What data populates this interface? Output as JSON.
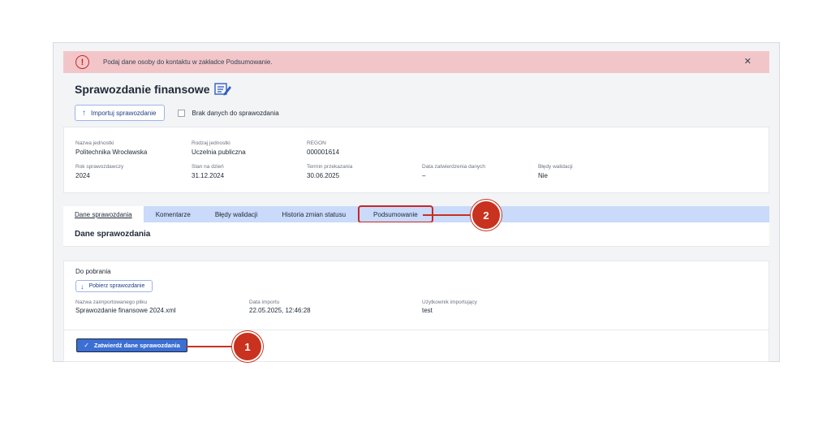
{
  "alert": {
    "text": "Podaj dane osoby do kontaktu w zakładce Podsumowanie.",
    "icon": "alert-circle-icon",
    "close": "✕"
  },
  "page": {
    "title": "Sprawozdanie finansowe"
  },
  "toolbar": {
    "import_label": "Importuj sprawozdanie",
    "no_data_label": "Brak danych do sprawozdania"
  },
  "info": {
    "row1": [
      {
        "label": "Nazwa jednostki",
        "value": "Politechnika Wrocławska"
      },
      {
        "label": "Rodzaj jednostki",
        "value": "Uczelnia publiczna"
      },
      {
        "label": "REGON",
        "value": "000001614"
      }
    ],
    "row2": [
      {
        "label": "Rok sprawozdawczy",
        "value": "2024"
      },
      {
        "label": "Stan na dzień",
        "value": "31.12.2024"
      },
      {
        "label": "Termin przekazania",
        "value": "30.06.2025"
      },
      {
        "label": "Data zatwierdzenia danych",
        "value": "–"
      },
      {
        "label": "Błędy walidacji",
        "value": "Nie"
      }
    ]
  },
  "tabs": [
    {
      "label": "Dane sprawozdania"
    },
    {
      "label": "Komentarze"
    },
    {
      "label": "Błędy walidacji"
    },
    {
      "label": "Historia zmian statusu"
    },
    {
      "label": "Podsumowanie"
    }
  ],
  "section": {
    "title": "Dane sprawozdania"
  },
  "download": {
    "title": "Do pobrania",
    "button": "Pobierz sprawozdanie",
    "fields": [
      {
        "label": "Nazwa zaimportowanego pliku",
        "value": "Sprawozdanie finansowe 2024.xml"
      },
      {
        "label": "Data importu",
        "value": "22.05.2025, 12:46:28"
      },
      {
        "label": "Użytkownik importujący",
        "value": "test"
      }
    ],
    "confirm_button": "Zatwierdź dane sprawozdania"
  },
  "callouts": [
    {
      "number": "1"
    },
    {
      "number": "2"
    }
  ],
  "colors": {
    "alert_bg": "#f2c6c9",
    "tabs_bg": "#c9dafa",
    "primary": "#3b6fd4",
    "callout": "#c8321e"
  }
}
